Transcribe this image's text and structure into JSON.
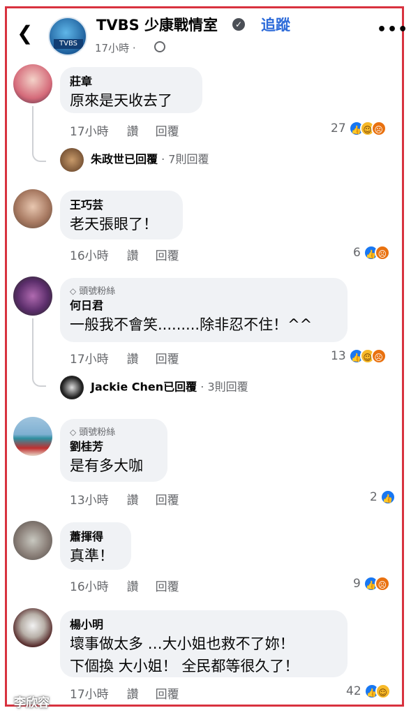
{
  "header": {
    "back_icon": "chevron-left-icon",
    "page_name": "TVBS 少康戰情室",
    "follow_label": "追蹤",
    "time": "17小時",
    "dot": "·",
    "more_icon": "more-dots-icon",
    "more_glyph": "•••"
  },
  "actions": {
    "like_label": "讚",
    "reply_label": "回覆"
  },
  "comments": [
    {
      "name": "莊章",
      "text": "原來是天收去了",
      "time": "17小時",
      "count": "27",
      "reply": {
        "who": "朱政世",
        "action": "已回覆",
        "sep": " · ",
        "count": "7則回覆"
      }
    },
    {
      "name": "王巧芸",
      "text": "老天張眼了！",
      "time": "16小時",
      "count": "6"
    },
    {
      "fan_badge": "頭號粉絲",
      "name": "何日君",
      "text": "一般我不會笑.........除非忍不住！^^",
      "time": "17小時",
      "count": "13",
      "reply": {
        "who": "Jackie Chen",
        "action": "已回覆",
        "sep": " · ",
        "count": "3則回覆"
      }
    },
    {
      "fan_badge": "頭號粉絲",
      "name": "劉桂芳",
      "text": "是有多大咖",
      "time": "13小時",
      "count": "2"
    },
    {
      "name": "蕭揮得",
      "text": "真準！",
      "time": "16小時",
      "count": "9"
    },
    {
      "name": "楊小明",
      "text": "壞事做太多 …大小姐也救不了妳！",
      "text2": "下個換 大小姐！ 全民都等很久了！",
      "time": "17小時",
      "count": "42"
    }
  ],
  "watermark": "李欣容",
  "colors": {
    "frame": "#d8323f",
    "link": "#2d6bd9",
    "bubble": "#f0f2f5",
    "like": "#1877f2"
  }
}
